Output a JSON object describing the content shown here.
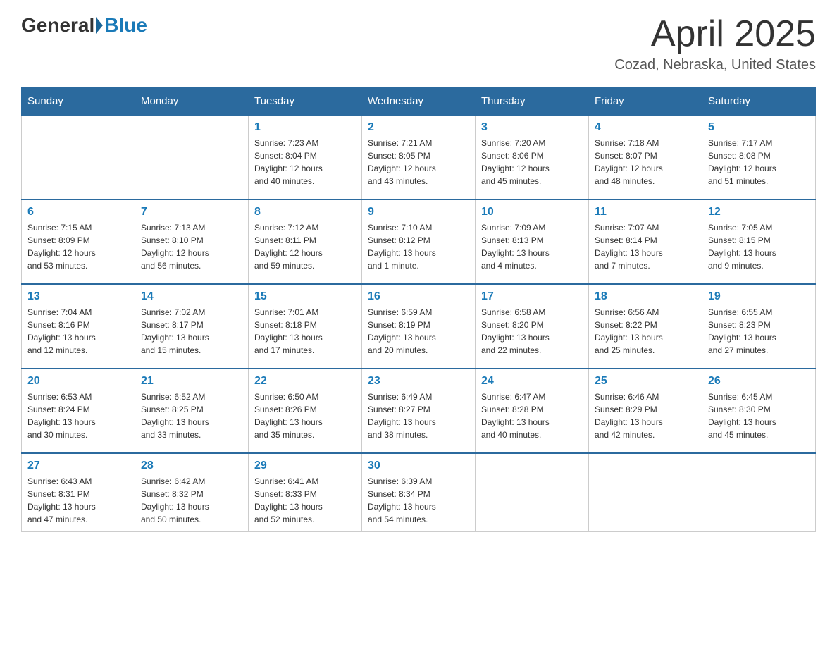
{
  "header": {
    "logo_general": "General",
    "logo_blue": "Blue",
    "title": "April 2025",
    "location": "Cozad, Nebraska, United States"
  },
  "days_of_week": [
    "Sunday",
    "Monday",
    "Tuesday",
    "Wednesday",
    "Thursday",
    "Friday",
    "Saturday"
  ],
  "weeks": [
    [
      {
        "num": "",
        "detail": ""
      },
      {
        "num": "",
        "detail": ""
      },
      {
        "num": "1",
        "detail": "Sunrise: 7:23 AM\nSunset: 8:04 PM\nDaylight: 12 hours\nand 40 minutes."
      },
      {
        "num": "2",
        "detail": "Sunrise: 7:21 AM\nSunset: 8:05 PM\nDaylight: 12 hours\nand 43 minutes."
      },
      {
        "num": "3",
        "detail": "Sunrise: 7:20 AM\nSunset: 8:06 PM\nDaylight: 12 hours\nand 45 minutes."
      },
      {
        "num": "4",
        "detail": "Sunrise: 7:18 AM\nSunset: 8:07 PM\nDaylight: 12 hours\nand 48 minutes."
      },
      {
        "num": "5",
        "detail": "Sunrise: 7:17 AM\nSunset: 8:08 PM\nDaylight: 12 hours\nand 51 minutes."
      }
    ],
    [
      {
        "num": "6",
        "detail": "Sunrise: 7:15 AM\nSunset: 8:09 PM\nDaylight: 12 hours\nand 53 minutes."
      },
      {
        "num": "7",
        "detail": "Sunrise: 7:13 AM\nSunset: 8:10 PM\nDaylight: 12 hours\nand 56 minutes."
      },
      {
        "num": "8",
        "detail": "Sunrise: 7:12 AM\nSunset: 8:11 PM\nDaylight: 12 hours\nand 59 minutes."
      },
      {
        "num": "9",
        "detail": "Sunrise: 7:10 AM\nSunset: 8:12 PM\nDaylight: 13 hours\nand 1 minute."
      },
      {
        "num": "10",
        "detail": "Sunrise: 7:09 AM\nSunset: 8:13 PM\nDaylight: 13 hours\nand 4 minutes."
      },
      {
        "num": "11",
        "detail": "Sunrise: 7:07 AM\nSunset: 8:14 PM\nDaylight: 13 hours\nand 7 minutes."
      },
      {
        "num": "12",
        "detail": "Sunrise: 7:05 AM\nSunset: 8:15 PM\nDaylight: 13 hours\nand 9 minutes."
      }
    ],
    [
      {
        "num": "13",
        "detail": "Sunrise: 7:04 AM\nSunset: 8:16 PM\nDaylight: 13 hours\nand 12 minutes."
      },
      {
        "num": "14",
        "detail": "Sunrise: 7:02 AM\nSunset: 8:17 PM\nDaylight: 13 hours\nand 15 minutes."
      },
      {
        "num": "15",
        "detail": "Sunrise: 7:01 AM\nSunset: 8:18 PM\nDaylight: 13 hours\nand 17 minutes."
      },
      {
        "num": "16",
        "detail": "Sunrise: 6:59 AM\nSunset: 8:19 PM\nDaylight: 13 hours\nand 20 minutes."
      },
      {
        "num": "17",
        "detail": "Sunrise: 6:58 AM\nSunset: 8:20 PM\nDaylight: 13 hours\nand 22 minutes."
      },
      {
        "num": "18",
        "detail": "Sunrise: 6:56 AM\nSunset: 8:22 PM\nDaylight: 13 hours\nand 25 minutes."
      },
      {
        "num": "19",
        "detail": "Sunrise: 6:55 AM\nSunset: 8:23 PM\nDaylight: 13 hours\nand 27 minutes."
      }
    ],
    [
      {
        "num": "20",
        "detail": "Sunrise: 6:53 AM\nSunset: 8:24 PM\nDaylight: 13 hours\nand 30 minutes."
      },
      {
        "num": "21",
        "detail": "Sunrise: 6:52 AM\nSunset: 8:25 PM\nDaylight: 13 hours\nand 33 minutes."
      },
      {
        "num": "22",
        "detail": "Sunrise: 6:50 AM\nSunset: 8:26 PM\nDaylight: 13 hours\nand 35 minutes."
      },
      {
        "num": "23",
        "detail": "Sunrise: 6:49 AM\nSunset: 8:27 PM\nDaylight: 13 hours\nand 38 minutes."
      },
      {
        "num": "24",
        "detail": "Sunrise: 6:47 AM\nSunset: 8:28 PM\nDaylight: 13 hours\nand 40 minutes."
      },
      {
        "num": "25",
        "detail": "Sunrise: 6:46 AM\nSunset: 8:29 PM\nDaylight: 13 hours\nand 42 minutes."
      },
      {
        "num": "26",
        "detail": "Sunrise: 6:45 AM\nSunset: 8:30 PM\nDaylight: 13 hours\nand 45 minutes."
      }
    ],
    [
      {
        "num": "27",
        "detail": "Sunrise: 6:43 AM\nSunset: 8:31 PM\nDaylight: 13 hours\nand 47 minutes."
      },
      {
        "num": "28",
        "detail": "Sunrise: 6:42 AM\nSunset: 8:32 PM\nDaylight: 13 hours\nand 50 minutes."
      },
      {
        "num": "29",
        "detail": "Sunrise: 6:41 AM\nSunset: 8:33 PM\nDaylight: 13 hours\nand 52 minutes."
      },
      {
        "num": "30",
        "detail": "Sunrise: 6:39 AM\nSunset: 8:34 PM\nDaylight: 13 hours\nand 54 minutes."
      },
      {
        "num": "",
        "detail": ""
      },
      {
        "num": "",
        "detail": ""
      },
      {
        "num": "",
        "detail": ""
      }
    ]
  ]
}
